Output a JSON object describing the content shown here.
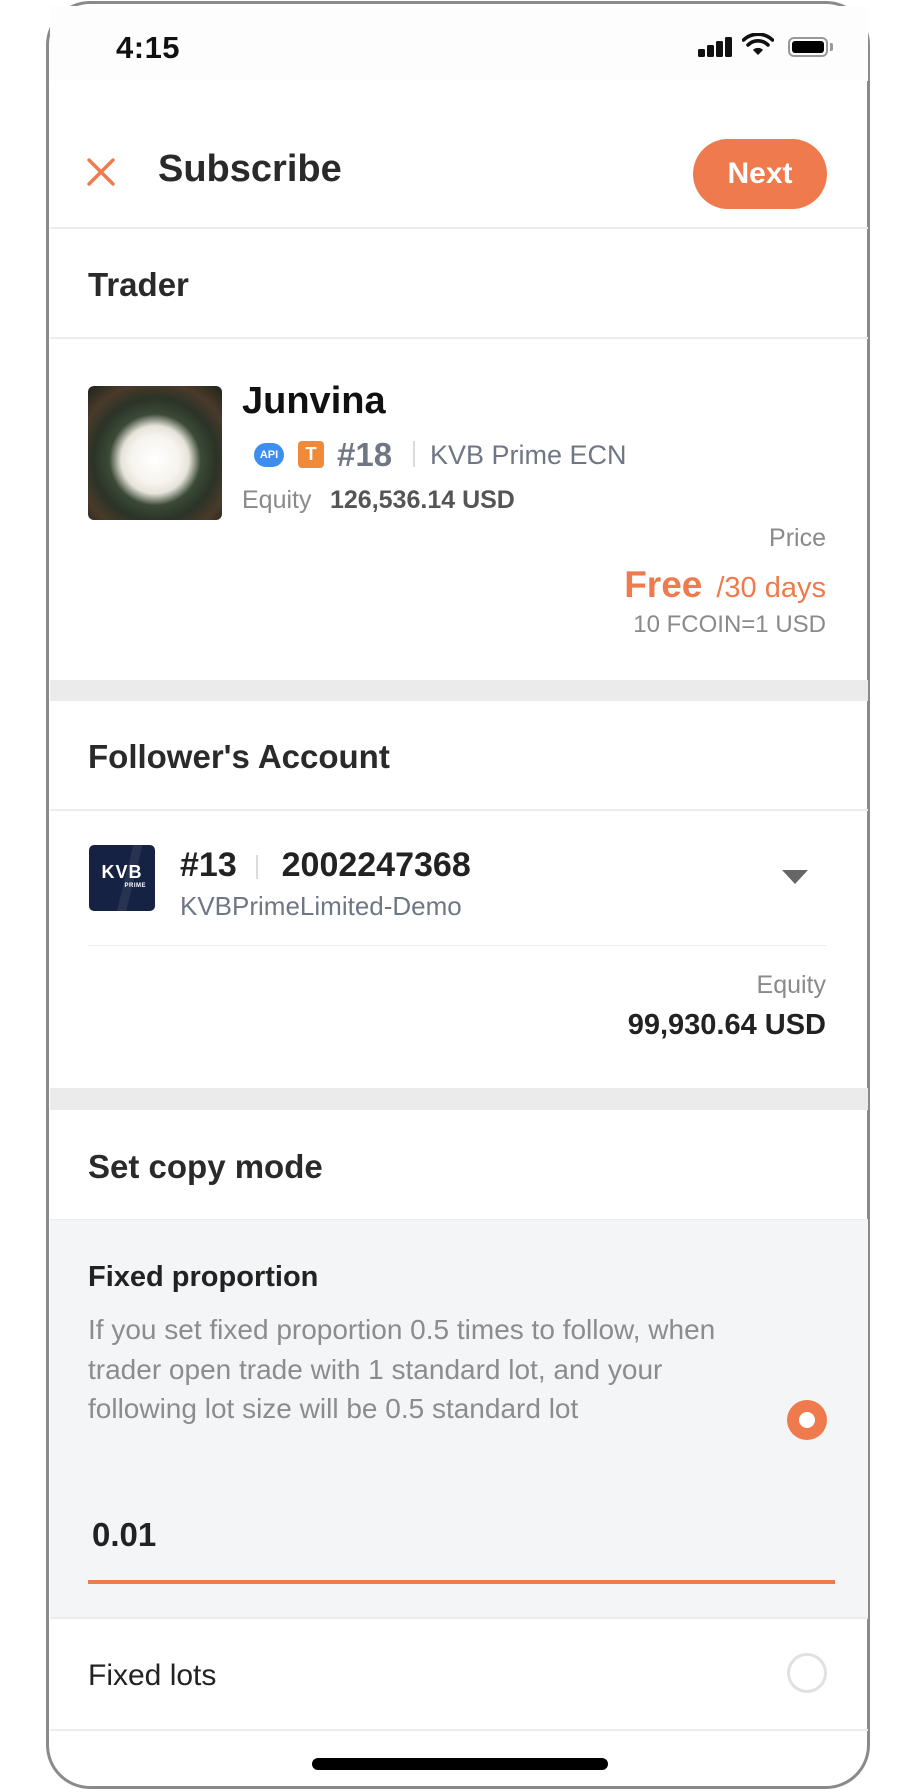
{
  "status_bar": {
    "time": "4:15",
    "icons": [
      "cellular-signal-icon",
      "wifi-icon",
      "battery-icon"
    ]
  },
  "header": {
    "close_icon": "close-icon",
    "title": "Subscribe",
    "next_label": "Next"
  },
  "colors": {
    "accent": "#ef7a4d",
    "api_badge": "#3d8ef0",
    "t_badge": "#f08a3a",
    "account_logo": "#152243"
  },
  "trader_section": {
    "title": "Trader",
    "trader": {
      "name": "Junvina",
      "badges": {
        "api": "API",
        "t": "T"
      },
      "rank": "#18",
      "server": "KVB Prime ECN",
      "equity_label": "Equity",
      "equity_value": "126,536.14 USD"
    },
    "price": {
      "label": "Price",
      "value": "Free",
      "period": "/30 days",
      "conversion": "10 FCOIN=1 USD"
    }
  },
  "follower_section": {
    "title": "Follower's Account",
    "account": {
      "logo_text": "KVB",
      "logo_subtext": "PRIME",
      "index": "#13",
      "number": "2002247368",
      "server": "KVBPrimeLimited-Demo",
      "equity_label": "Equity",
      "equity_value": "99,930.64 USD"
    }
  },
  "copy_mode_section": {
    "title": "Set copy mode",
    "options": [
      {
        "label": "Fixed proportion",
        "description": "If you set fixed proportion 0.5 times to follow, when trader open trade with 1 standard lot, and your following lot size will be 0.5 standard lot",
        "selected": true,
        "input_value": "0.01"
      },
      {
        "label": "Fixed lots",
        "selected": false
      }
    ]
  }
}
